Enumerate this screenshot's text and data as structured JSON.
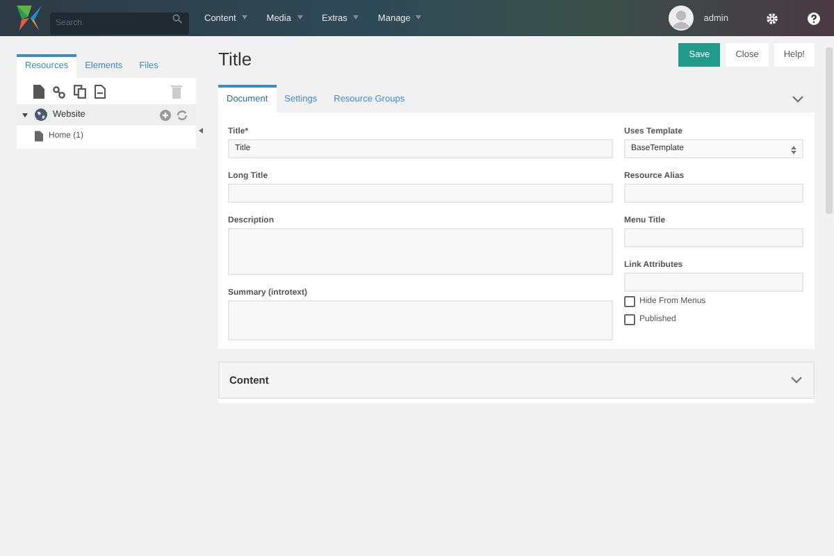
{
  "header": {
    "search": {
      "placeholder": "Search"
    },
    "menu": [
      "Content",
      "Media",
      "Extras",
      "Manage"
    ],
    "user": "admin"
  },
  "sidebar": {
    "tabs": [
      {
        "label": "Resources",
        "selected": true
      },
      {
        "label": "Elements",
        "selected": false
      },
      {
        "label": "Files",
        "selected": false
      }
    ],
    "tree": [
      {
        "label": "Website",
        "expanded": true,
        "children": [
          {
            "label": "Home (1)"
          }
        ]
      }
    ]
  },
  "page": {
    "title": "Title",
    "buttons": [
      {
        "label": "Save",
        "kind": "primary"
      },
      {
        "label": "Close",
        "kind": "plain"
      },
      {
        "label": "Help!",
        "kind": "plain"
      }
    ]
  },
  "tabs": [
    {
      "label": "Document",
      "selected": true
    },
    {
      "label": "Settings",
      "selected": false
    },
    {
      "label": "Resource Groups",
      "selected": false
    }
  ],
  "left_fields": [
    {
      "label": "Title*",
      "kind": "input",
      "value": "Title"
    },
    {
      "label": "Long Title",
      "kind": "input"
    },
    {
      "label": "Description",
      "kind": "textarea"
    },
    {
      "label": "Summary (introtext)",
      "kind": "textarea"
    }
  ],
  "right_fields": [
    {
      "label": "Uses Template",
      "kind": "select",
      "value": "BaseTemplate"
    },
    {
      "label": "Resource Alias",
      "kind": "input"
    },
    {
      "label": "Menu Title",
      "kind": "input"
    },
    {
      "label": "Link Attributes",
      "kind": "input"
    }
  ],
  "checkboxes": [
    {
      "label": "Hide From Menus",
      "checked": false
    },
    {
      "label": "Published",
      "checked": false
    }
  ],
  "section": {
    "title": "Content"
  }
}
